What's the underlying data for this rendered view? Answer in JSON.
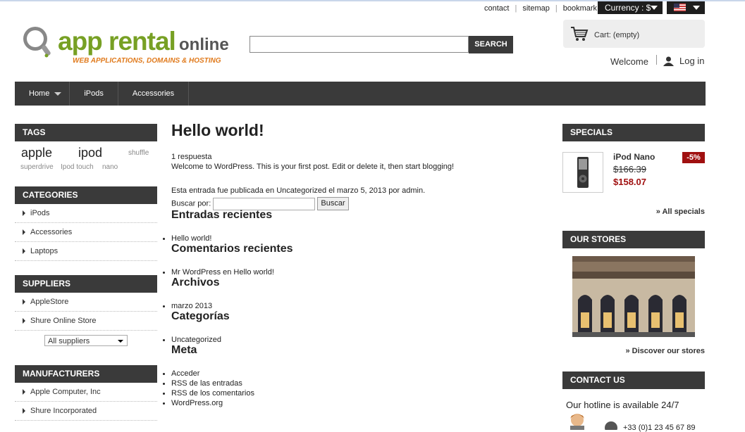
{
  "toplinks": [
    "contact",
    "sitemap",
    "bookmark"
  ],
  "currency_label": "Currency : $",
  "logo": {
    "word1": "app rental",
    "word2": "online",
    "tagline": "WEB APPLICATIONS, DOMAINS & HOSTING"
  },
  "search": {
    "value": "",
    "button": "SEARCH"
  },
  "cart": {
    "label": "Cart: (empty)"
  },
  "user": {
    "welcome": "Welcome",
    "login": "Log in"
  },
  "nav": [
    "Home",
    "iPods",
    "Accessories"
  ],
  "tags": {
    "title": "TAGS",
    "items": [
      "apple",
      "ipod",
      "shuffle",
      "superdrive",
      "Ipod touch",
      "nano"
    ]
  },
  "categories": {
    "title": "CATEGORIES",
    "items": [
      "iPods",
      "Accessories",
      "Laptops"
    ]
  },
  "suppliers": {
    "title": "SUPPLIERS",
    "items": [
      "AppleStore",
      "Shure Online Store"
    ],
    "select": "All suppliers"
  },
  "manufacturers": {
    "title": "MANUFACTURERS",
    "items": [
      "Apple Computer, Inc",
      "Shure Incorporated"
    ]
  },
  "post": {
    "title": "Hello world!",
    "replies": "1 respuesta",
    "body": "Welcome to WordPress. This is your first post. Edit or delete it, then start blogging!",
    "meta": "Esta entrada fue publicada en Uncategorized el marzo 5, 2013 por admin.",
    "search_label": "Buscar por:",
    "search_button": "Buscar"
  },
  "widgets": {
    "recent_title": "Entradas recientes",
    "recent_items": [
      "Hello world!"
    ],
    "comments_title": "Comentarios recientes",
    "comments_items": [
      "Mr WordPress en Hello world!"
    ],
    "archives_title": "Archivos",
    "archives_items": [
      "marzo 2013"
    ],
    "cats_title": "Categorías",
    "cats_items": [
      "Uncategorized"
    ],
    "meta_title": "Meta",
    "meta_items": [
      "Acceder",
      "RSS de las entradas",
      "RSS de los comentarios",
      "WordPress.org"
    ]
  },
  "specials": {
    "title": "SPECIALS",
    "product": "iPod Nano",
    "old_price": "$166.39",
    "new_price": "$158.07",
    "discount": "-5%",
    "link": "» All specials"
  },
  "stores": {
    "title": "OUR STORES",
    "link": "» Discover our stores"
  },
  "contact": {
    "title": "CONTACT US",
    "hotline": "Our hotline is available 24/7",
    "phone": "+33 (0)1 23 45 67 89"
  },
  "colors": {
    "dark": "#3a3a3a",
    "logo_green": "#77a024",
    "logo_orange": "#e07a1c",
    "price_red": "#a01010"
  }
}
